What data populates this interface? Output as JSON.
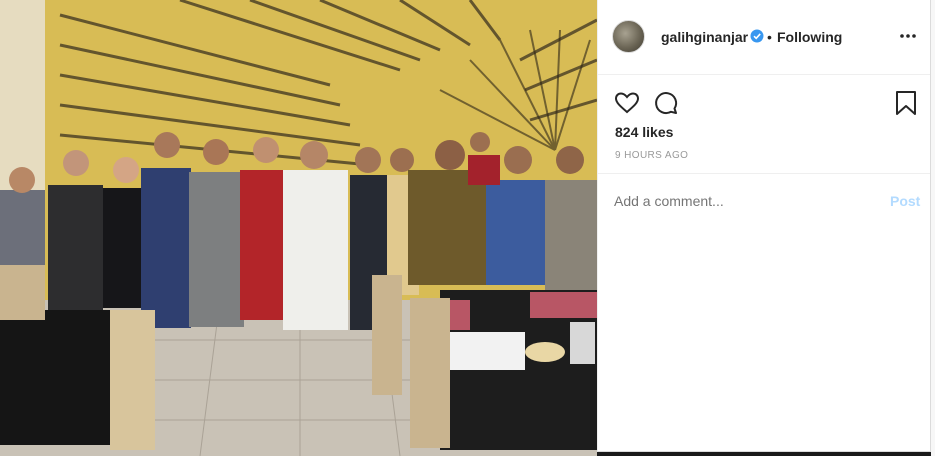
{
  "post": {
    "username": "galihginanjar",
    "separator": "•",
    "follow_status": "Following",
    "likes": "824 likes",
    "timestamp": "9 HOURS AGO"
  },
  "comment_box": {
    "placeholder": "Add a comment...",
    "post_label": "Post"
  },
  "icons": {
    "avatar": "profile-avatar",
    "verified": "verified-badge-icon",
    "more": "more-options-icon",
    "like": "heart-icon",
    "comment": "comment-icon",
    "save": "bookmark-icon"
  },
  "colors": {
    "text": "#262626",
    "muted": "#999999",
    "verified_blue": "#3897f0",
    "post_disabled": "#b3dbff",
    "border": "#efefef"
  }
}
